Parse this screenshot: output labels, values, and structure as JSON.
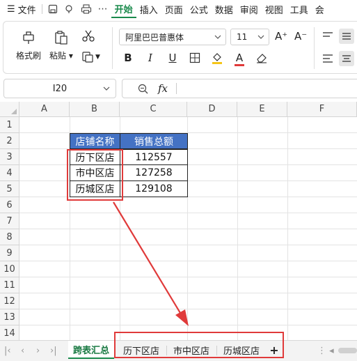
{
  "menu": {
    "file_label": "文件",
    "tabs": [
      "开始",
      "插入",
      "页面",
      "公式",
      "数据",
      "审阅",
      "视图",
      "工具",
      "会"
    ],
    "active_tab": "开始"
  },
  "ribbon": {
    "format_painter_label": "格式刷",
    "paste_label": "粘贴",
    "font_name": "阿里巴巴普惠体",
    "font_size": "11",
    "bold_label": "B",
    "italic_label": "I",
    "underline_label": "U",
    "grow_label": "A⁺",
    "shrink_label": "A⁻",
    "font_color_label": "A"
  },
  "formula_bar": {
    "cell_ref": "I20",
    "fx_label": "fx",
    "formula": ""
  },
  "sheet": {
    "columns": [
      "A",
      "B",
      "C",
      "D",
      "E",
      "F"
    ],
    "rows": [
      "1",
      "2",
      "3",
      "4",
      "5",
      "6",
      "7",
      "8",
      "9",
      "10",
      "11",
      "12",
      "13",
      "14"
    ],
    "table": {
      "header": [
        "店铺名称",
        "销售总额"
      ],
      "rows": [
        [
          "历下区店",
          "112557"
        ],
        [
          "市中区店",
          "127258"
        ],
        [
          "历城区店",
          "129108"
        ]
      ]
    }
  },
  "tabs": {
    "sheets": [
      "跨表汇总",
      "历下区店",
      "市中区店",
      "历城区店"
    ],
    "active": "跨表汇总",
    "add_label": "+"
  },
  "colors": {
    "accent": "#1a8a4c",
    "header_fill": "#4472c4",
    "annotation": "#e03a3a"
  }
}
